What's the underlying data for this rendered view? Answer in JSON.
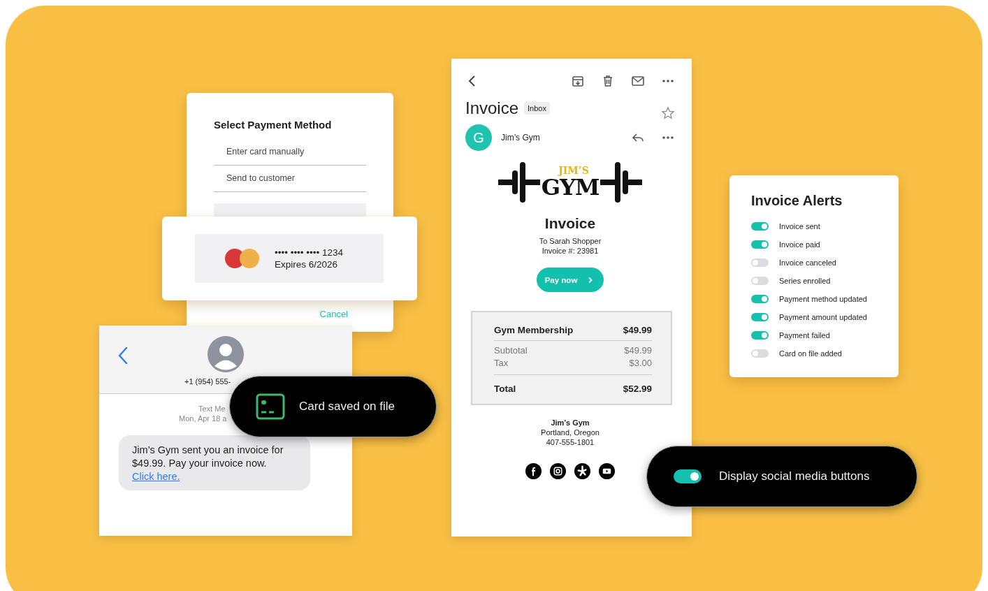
{
  "payment_dialog": {
    "title": "Select Payment Method",
    "options": [
      {
        "label": "Enter card manually"
      },
      {
        "label": "Send to customer"
      }
    ],
    "cancel": "Cancel"
  },
  "saved_card": {
    "number": "•••• •••• •••• 1234",
    "expiry": "Expires 6/2026"
  },
  "sms": {
    "contact": "+1 (954) 555-",
    "service": "Text Me",
    "date": "Mon, Apr 18 a",
    "message": "Jim’s Gym sent you an invoice for $49.99. Pay your invoice now.",
    "link": "Click here."
  },
  "card_toast": {
    "label": "Card saved on file"
  },
  "email": {
    "subject": "Invoice",
    "folder": "Inbox",
    "sender_initial": "G",
    "sender": "Jim’s Gym",
    "logo": {
      "top": "JIM’S",
      "main": "GYM"
    },
    "heading": "Invoice",
    "recipient": "To Sarah Shopper",
    "number": "Invoice #: 23981",
    "pay_button": "Pay now",
    "line_items": [
      {
        "kind": "item",
        "label": "Gym Membership",
        "amount": "$49.99"
      },
      {
        "kind": "sub",
        "label": "Subtotal",
        "amount": "$49.99"
      },
      {
        "kind": "sub",
        "label": "Tax",
        "amount": "$3.00"
      },
      {
        "kind": "total",
        "label": "Total",
        "amount": "$52.99"
      }
    ],
    "footer": {
      "name": "Jim’s Gym",
      "city": "Portland, Oregon",
      "phone": "407-555-1801"
    }
  },
  "alerts": {
    "title": "Invoice Alerts",
    "items": [
      {
        "label": "Invoice sent",
        "on": true
      },
      {
        "label": "Invoice paid",
        "on": true
      },
      {
        "label": "Invoice canceled",
        "on": false
      },
      {
        "label": "Series enrolled",
        "on": false
      },
      {
        "label": "Payment method updated",
        "on": true
      },
      {
        "label": "Payment amount updated",
        "on": true
      },
      {
        "label": "Payment failed",
        "on": true
      },
      {
        "label": "Card on file added",
        "on": false
      }
    ]
  },
  "social_toast": {
    "label": "Display social media buttons",
    "on": true
  }
}
